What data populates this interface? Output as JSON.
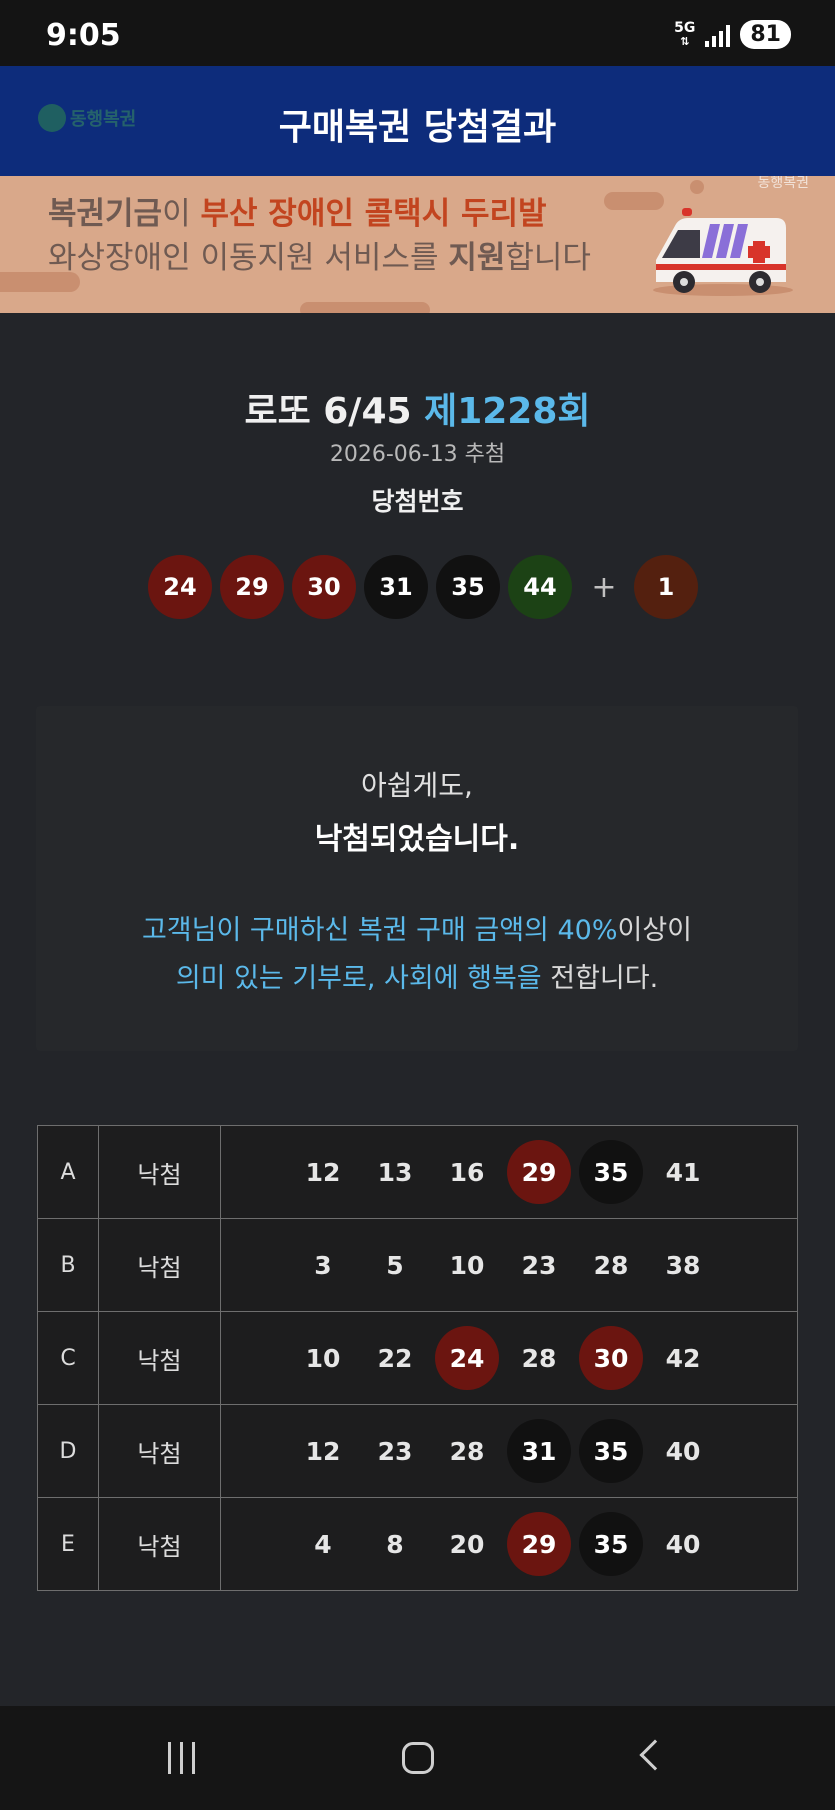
{
  "status_bar": {
    "time": "9:05",
    "network": "5G",
    "battery": "81"
  },
  "header": {
    "logo_text": "동행복권",
    "title": "구매복권 당첨결과"
  },
  "banner": {
    "line1_part1": "복권기금",
    "line1_part2": "이 ",
    "line1_part3": "부산 장애인 콜택시 두리발",
    "line2_part1": "와상장애인 이동지원 서비스를 ",
    "line2_part2": "지원",
    "line2_part3": "합니다",
    "brand": "동행복권"
  },
  "draw": {
    "game": "로또 6/45",
    "round": "제1228회",
    "date": "2026-06-13 추첨",
    "numbers_label": "당첨번호",
    "plus": "+",
    "winning_numbers": [
      {
        "n": "24",
        "color": "#6b1510"
      },
      {
        "n": "29",
        "color": "#6b1510"
      },
      {
        "n": "30",
        "color": "#6b1510"
      },
      {
        "n": "31",
        "color": "#111111"
      },
      {
        "n": "35",
        "color": "#111111"
      },
      {
        "n": "44",
        "color": "#1c4215"
      }
    ],
    "bonus": {
      "n": "1",
      "color": "#54200f"
    }
  },
  "result": {
    "line1": "아쉽게도,",
    "line2": "낙첨되었습니다.",
    "line3": "고객님이 구매하신 복권 구매 금액의 40%",
    "line3_tail": "이상이",
    "line4_a": "의미 있는 기부로, 사회에 행복을 ",
    "line4_b": "전합니다."
  },
  "tickets": [
    {
      "label": "A",
      "status": "낙첨",
      "numbers": [
        {
          "n": "12",
          "bg": ""
        },
        {
          "n": "13",
          "bg": ""
        },
        {
          "n": "16",
          "bg": ""
        },
        {
          "n": "29",
          "bg": "#6b1510"
        },
        {
          "n": "35",
          "bg": "#111111"
        },
        {
          "n": "41",
          "bg": ""
        }
      ]
    },
    {
      "label": "B",
      "status": "낙첨",
      "numbers": [
        {
          "n": "3",
          "bg": ""
        },
        {
          "n": "5",
          "bg": ""
        },
        {
          "n": "10",
          "bg": ""
        },
        {
          "n": "23",
          "bg": ""
        },
        {
          "n": "28",
          "bg": ""
        },
        {
          "n": "38",
          "bg": ""
        }
      ]
    },
    {
      "label": "C",
      "status": "낙첨",
      "numbers": [
        {
          "n": "10",
          "bg": ""
        },
        {
          "n": "22",
          "bg": ""
        },
        {
          "n": "24",
          "bg": "#6b1510"
        },
        {
          "n": "28",
          "bg": ""
        },
        {
          "n": "30",
          "bg": "#6b1510"
        },
        {
          "n": "42",
          "bg": ""
        }
      ]
    },
    {
      "label": "D",
      "status": "낙첨",
      "numbers": [
        {
          "n": "12",
          "bg": ""
        },
        {
          "n": "23",
          "bg": ""
        },
        {
          "n": "28",
          "bg": ""
        },
        {
          "n": "31",
          "bg": "#111111"
        },
        {
          "n": "35",
          "bg": "#111111"
        },
        {
          "n": "40",
          "bg": ""
        }
      ]
    },
    {
      "label": "E",
      "status": "낙첨",
      "numbers": [
        {
          "n": "4",
          "bg": ""
        },
        {
          "n": "8",
          "bg": ""
        },
        {
          "n": "20",
          "bg": ""
        },
        {
          "n": "29",
          "bg": "#6b1510"
        },
        {
          "n": "35",
          "bg": "#111111"
        },
        {
          "n": "40",
          "bg": ""
        }
      ]
    }
  ],
  "nav": {
    "recent": "recent-apps-icon",
    "home": "home-icon",
    "back": "back-icon"
  }
}
